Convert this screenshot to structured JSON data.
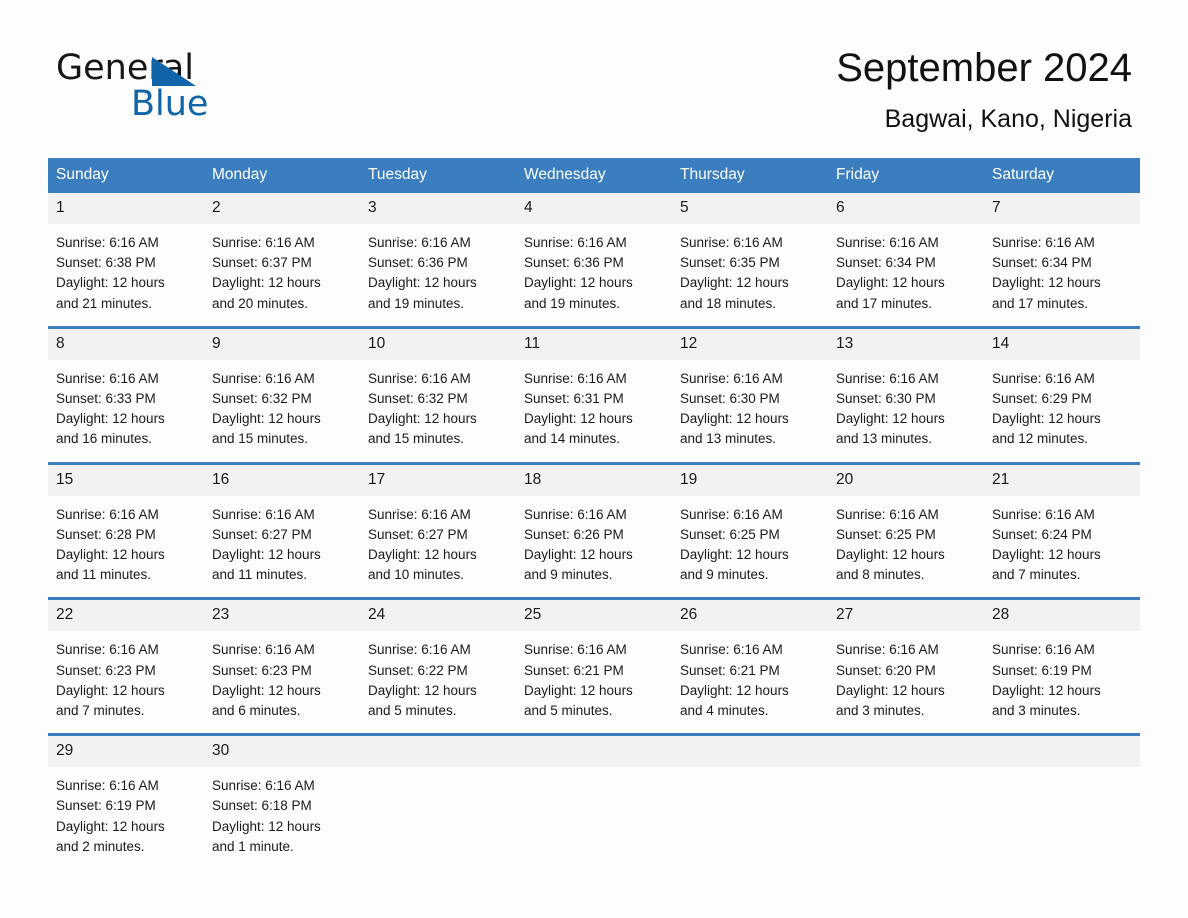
{
  "brand": {
    "name_part1": "General",
    "name_part2": "Blue",
    "accent_color": "#1065a8",
    "triangle_icon": "triangle-icon"
  },
  "header": {
    "title": "September 2024",
    "subtitle": "Bagwai, Kano, Nigeria"
  },
  "theme": {
    "header_row_color": "#3a7ebf",
    "daynum_band_color": "#f2f2f2",
    "page_background": "#fdfdfd",
    "text_color": "#1a1a1a"
  },
  "calendar": {
    "weekday_headers": [
      "Sunday",
      "Monday",
      "Tuesday",
      "Wednesday",
      "Thursday",
      "Friday",
      "Saturday"
    ],
    "weeks": [
      [
        {
          "day": "1",
          "sunrise": "Sunrise: 6:16 AM",
          "sunset": "Sunset: 6:38 PM",
          "daylight_line1": "Daylight: 12 hours",
          "daylight_line2": "and 21 minutes."
        },
        {
          "day": "2",
          "sunrise": "Sunrise: 6:16 AM",
          "sunset": "Sunset: 6:37 PM",
          "daylight_line1": "Daylight: 12 hours",
          "daylight_line2": "and 20 minutes."
        },
        {
          "day": "3",
          "sunrise": "Sunrise: 6:16 AM",
          "sunset": "Sunset: 6:36 PM",
          "daylight_line1": "Daylight: 12 hours",
          "daylight_line2": "and 19 minutes."
        },
        {
          "day": "4",
          "sunrise": "Sunrise: 6:16 AM",
          "sunset": "Sunset: 6:36 PM",
          "daylight_line1": "Daylight: 12 hours",
          "daylight_line2": "and 19 minutes."
        },
        {
          "day": "5",
          "sunrise": "Sunrise: 6:16 AM",
          "sunset": "Sunset: 6:35 PM",
          "daylight_line1": "Daylight: 12 hours",
          "daylight_line2": "and 18 minutes."
        },
        {
          "day": "6",
          "sunrise": "Sunrise: 6:16 AM",
          "sunset": "Sunset: 6:34 PM",
          "daylight_line1": "Daylight: 12 hours",
          "daylight_line2": "and 17 minutes."
        },
        {
          "day": "7",
          "sunrise": "Sunrise: 6:16 AM",
          "sunset": "Sunset: 6:34 PM",
          "daylight_line1": "Daylight: 12 hours",
          "daylight_line2": "and 17 minutes."
        }
      ],
      [
        {
          "day": "8",
          "sunrise": "Sunrise: 6:16 AM",
          "sunset": "Sunset: 6:33 PM",
          "daylight_line1": "Daylight: 12 hours",
          "daylight_line2": "and 16 minutes."
        },
        {
          "day": "9",
          "sunrise": "Sunrise: 6:16 AM",
          "sunset": "Sunset: 6:32 PM",
          "daylight_line1": "Daylight: 12 hours",
          "daylight_line2": "and 15 minutes."
        },
        {
          "day": "10",
          "sunrise": "Sunrise: 6:16 AM",
          "sunset": "Sunset: 6:32 PM",
          "daylight_line1": "Daylight: 12 hours",
          "daylight_line2": "and 15 minutes."
        },
        {
          "day": "11",
          "sunrise": "Sunrise: 6:16 AM",
          "sunset": "Sunset: 6:31 PM",
          "daylight_line1": "Daylight: 12 hours",
          "daylight_line2": "and 14 minutes."
        },
        {
          "day": "12",
          "sunrise": "Sunrise: 6:16 AM",
          "sunset": "Sunset: 6:30 PM",
          "daylight_line1": "Daylight: 12 hours",
          "daylight_line2": "and 13 minutes."
        },
        {
          "day": "13",
          "sunrise": "Sunrise: 6:16 AM",
          "sunset": "Sunset: 6:30 PM",
          "daylight_line1": "Daylight: 12 hours",
          "daylight_line2": "and 13 minutes."
        },
        {
          "day": "14",
          "sunrise": "Sunrise: 6:16 AM",
          "sunset": "Sunset: 6:29 PM",
          "daylight_line1": "Daylight: 12 hours",
          "daylight_line2": "and 12 minutes."
        }
      ],
      [
        {
          "day": "15",
          "sunrise": "Sunrise: 6:16 AM",
          "sunset": "Sunset: 6:28 PM",
          "daylight_line1": "Daylight: 12 hours",
          "daylight_line2": "and 11 minutes."
        },
        {
          "day": "16",
          "sunrise": "Sunrise: 6:16 AM",
          "sunset": "Sunset: 6:27 PM",
          "daylight_line1": "Daylight: 12 hours",
          "daylight_line2": "and 11 minutes."
        },
        {
          "day": "17",
          "sunrise": "Sunrise: 6:16 AM",
          "sunset": "Sunset: 6:27 PM",
          "daylight_line1": "Daylight: 12 hours",
          "daylight_line2": "and 10 minutes."
        },
        {
          "day": "18",
          "sunrise": "Sunrise: 6:16 AM",
          "sunset": "Sunset: 6:26 PM",
          "daylight_line1": "Daylight: 12 hours",
          "daylight_line2": "and 9 minutes."
        },
        {
          "day": "19",
          "sunrise": "Sunrise: 6:16 AM",
          "sunset": "Sunset: 6:25 PM",
          "daylight_line1": "Daylight: 12 hours",
          "daylight_line2": "and 9 minutes."
        },
        {
          "day": "20",
          "sunrise": "Sunrise: 6:16 AM",
          "sunset": "Sunset: 6:25 PM",
          "daylight_line1": "Daylight: 12 hours",
          "daylight_line2": "and 8 minutes."
        },
        {
          "day": "21",
          "sunrise": "Sunrise: 6:16 AM",
          "sunset": "Sunset: 6:24 PM",
          "daylight_line1": "Daylight: 12 hours",
          "daylight_line2": "and 7 minutes."
        }
      ],
      [
        {
          "day": "22",
          "sunrise": "Sunrise: 6:16 AM",
          "sunset": "Sunset: 6:23 PM",
          "daylight_line1": "Daylight: 12 hours",
          "daylight_line2": "and 7 minutes."
        },
        {
          "day": "23",
          "sunrise": "Sunrise: 6:16 AM",
          "sunset": "Sunset: 6:23 PM",
          "daylight_line1": "Daylight: 12 hours",
          "daylight_line2": "and 6 minutes."
        },
        {
          "day": "24",
          "sunrise": "Sunrise: 6:16 AM",
          "sunset": "Sunset: 6:22 PM",
          "daylight_line1": "Daylight: 12 hours",
          "daylight_line2": "and 5 minutes."
        },
        {
          "day": "25",
          "sunrise": "Sunrise: 6:16 AM",
          "sunset": "Sunset: 6:21 PM",
          "daylight_line1": "Daylight: 12 hours",
          "daylight_line2": "and 5 minutes."
        },
        {
          "day": "26",
          "sunrise": "Sunrise: 6:16 AM",
          "sunset": "Sunset: 6:21 PM",
          "daylight_line1": "Daylight: 12 hours",
          "daylight_line2": "and 4 minutes."
        },
        {
          "day": "27",
          "sunrise": "Sunrise: 6:16 AM",
          "sunset": "Sunset: 6:20 PM",
          "daylight_line1": "Daylight: 12 hours",
          "daylight_line2": "and 3 minutes."
        },
        {
          "day": "28",
          "sunrise": "Sunrise: 6:16 AM",
          "sunset": "Sunset: 6:19 PM",
          "daylight_line1": "Daylight: 12 hours",
          "daylight_line2": "and 3 minutes."
        }
      ],
      [
        {
          "day": "29",
          "sunrise": "Sunrise: 6:16 AM",
          "sunset": "Sunset: 6:19 PM",
          "daylight_line1": "Daylight: 12 hours",
          "daylight_line2": "and 2 minutes."
        },
        {
          "day": "30",
          "sunrise": "Sunrise: 6:16 AM",
          "sunset": "Sunset: 6:18 PM",
          "daylight_line1": "Daylight: 12 hours",
          "daylight_line2": "and 1 minute."
        },
        {
          "day": "",
          "sunrise": "",
          "sunset": "",
          "daylight_line1": "",
          "daylight_line2": ""
        },
        {
          "day": "",
          "sunrise": "",
          "sunset": "",
          "daylight_line1": "",
          "daylight_line2": ""
        },
        {
          "day": "",
          "sunrise": "",
          "sunset": "",
          "daylight_line1": "",
          "daylight_line2": ""
        },
        {
          "day": "",
          "sunrise": "",
          "sunset": "",
          "daylight_line1": "",
          "daylight_line2": ""
        },
        {
          "day": "",
          "sunrise": "",
          "sunset": "",
          "daylight_line1": "",
          "daylight_line2": ""
        }
      ]
    ]
  }
}
